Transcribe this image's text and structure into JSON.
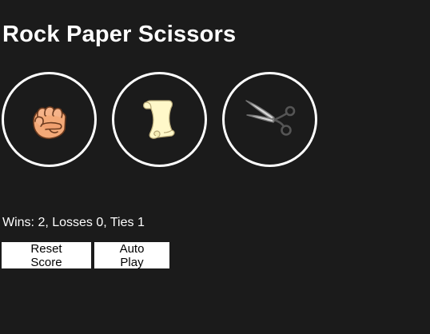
{
  "game": {
    "title": "Rock Paper Scissors",
    "moves": [
      {
        "icon": "fist-icon",
        "name": "rock"
      },
      {
        "icon": "paper-scroll-icon",
        "name": "paper"
      },
      {
        "icon": "scissors-icon",
        "name": "scissors"
      }
    ],
    "score_text": "Wins: 2, Losses 0, Ties 1",
    "score": {
      "wins": 2,
      "losses": 0,
      "ties": 1
    },
    "reset_label": "Reset Score",
    "auto_play_label": "Auto Play"
  },
  "colors": {
    "background": "#1b1b1b",
    "text": "#ffffff",
    "button_background": "#ffffff",
    "button_text": "#000000"
  }
}
